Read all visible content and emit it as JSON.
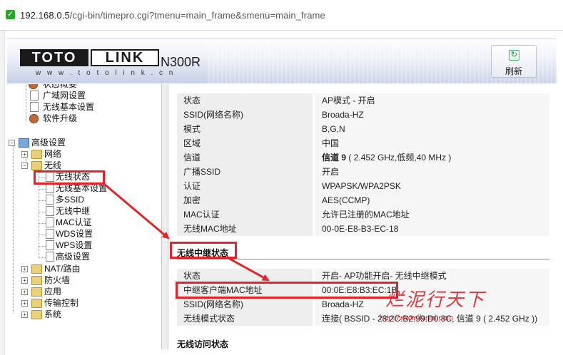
{
  "browser": {
    "url_host": "192.168.0.5",
    "url_path": "/cgi-bin/timepro.cgi?tmenu=main_frame&smenu=main_frame"
  },
  "header": {
    "logo_left": "TOTO",
    "logo_right": "LINK",
    "site": "w w w . t o t o l i n k . c n",
    "model": "N300R",
    "refresh_label": "刷新"
  },
  "tree": {
    "top_partial": "状态概要",
    "wan": "广域网设置",
    "wireless_basic": "无线基本设置",
    "firmware": "软件升级",
    "advanced": "高级设置",
    "network": "网络",
    "wireless": "无线",
    "wireless_status": "无线状态",
    "wireless_basic_sub": "无线基本设置",
    "multi_ssid": "多SSID",
    "repeater": "无线中继",
    "mac_auth": "MAC认证",
    "wds": "WDS设置",
    "wps": "WPS设置",
    "adv": "高级设置",
    "nat": "NAT/路由",
    "firewall": "防火墙",
    "apps": "应用",
    "traffic": "传输控制",
    "system": "系统"
  },
  "wireless_info": [
    {
      "k": "状态",
      "v": "AP模式 - 开启"
    },
    {
      "k": "SSID(网络名称)",
      "v": "Broada-HZ"
    },
    {
      "k": "模式",
      "v": "B,G,N"
    },
    {
      "k": "区域",
      "v": "中国"
    },
    {
      "k": "信道",
      "v_bold": "信道 9",
      "v": "( 2.452 GHz,低频,40 MHz )"
    },
    {
      "k": "广播SSID",
      "v": "开启"
    },
    {
      "k": "认证",
      "v": "WPAPSK/WPA2PSK"
    },
    {
      "k": "加密",
      "v": "AES(CCMP)"
    },
    {
      "k": "MAC认证",
      "v": "允许已注册的MAC地址"
    },
    {
      "k": "无线MAC地址",
      "v": "00-0E-E8-B3-EC-18"
    }
  ],
  "repeater_section": {
    "title": "无线中继状态",
    "rows": [
      {
        "k": "状态",
        "v": "开启- AP功能开启- 无线中继模式"
      },
      {
        "k": "中继客户端MAC地址",
        "v": "00:0E:E8:B3:EC:1B"
      },
      {
        "k": "SSID(网络名称)",
        "v": "Broada-HZ"
      },
      {
        "k": "无线模式状态",
        "v": "连接( BSSID - 28:2C:B2:99:D0:8C, 信道 9 ( 2.452 GHz ))"
      }
    ]
  },
  "next_section_partial": "无线访问状态",
  "watermark": {
    "text": "烂泥行天下",
    "url": "http://www.ilanni.com"
  },
  "colors": {
    "highlight": "#e2232b",
    "key_bg": "#eeeeee",
    "value_bg": "#f6f6f6"
  }
}
